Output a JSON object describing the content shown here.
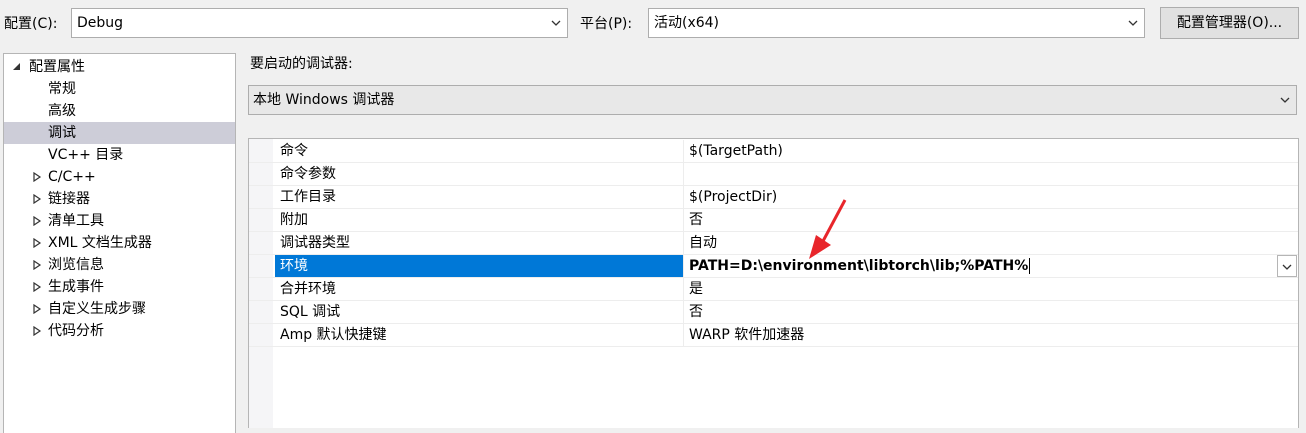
{
  "topbar": {
    "config_label": "配置(C):",
    "config_value": "Debug",
    "platform_label": "平台(P):",
    "platform_value": "活动(x64)",
    "config_manager_label": "配置管理器(O)..."
  },
  "tree": {
    "root": "配置属性",
    "items": [
      {
        "label": "常规",
        "expandable": false
      },
      {
        "label": "高级",
        "expandable": false
      },
      {
        "label": "调试",
        "expandable": false,
        "selected": true
      },
      {
        "label": "VC++ 目录",
        "expandable": false
      },
      {
        "label": "C/C++",
        "expandable": true
      },
      {
        "label": "链接器",
        "expandable": true
      },
      {
        "label": "清单工具",
        "expandable": true
      },
      {
        "label": "XML 文档生成器",
        "expandable": true
      },
      {
        "label": "浏览信息",
        "expandable": true
      },
      {
        "label": "生成事件",
        "expandable": true
      },
      {
        "label": "自定义生成步骤",
        "expandable": true
      },
      {
        "label": "代码分析",
        "expandable": true
      }
    ]
  },
  "debugger": {
    "label": "要启动的调试器:",
    "value": "本地 Windows 调试器"
  },
  "properties": [
    {
      "name": "命令",
      "value": "$(TargetPath)"
    },
    {
      "name": "命令参数",
      "value": ""
    },
    {
      "name": "工作目录",
      "value": "$(ProjectDir)"
    },
    {
      "name": "附加",
      "value": "否"
    },
    {
      "name": "调试器类型",
      "value": "自动"
    },
    {
      "name": "环境",
      "value": "PATH=D:\\environment\\libtorch\\lib;%PATH%",
      "selected": true
    },
    {
      "name": "合并环境",
      "value": "是"
    },
    {
      "name": "SQL 调试",
      "value": "否"
    },
    {
      "name": "Amp 默认快捷键",
      "value": "WARP 软件加速器"
    }
  ],
  "colors": {
    "selection_blue": "#0078d7",
    "tree_selected": "#cdcdd8",
    "annotation_red": "#e8262b"
  }
}
